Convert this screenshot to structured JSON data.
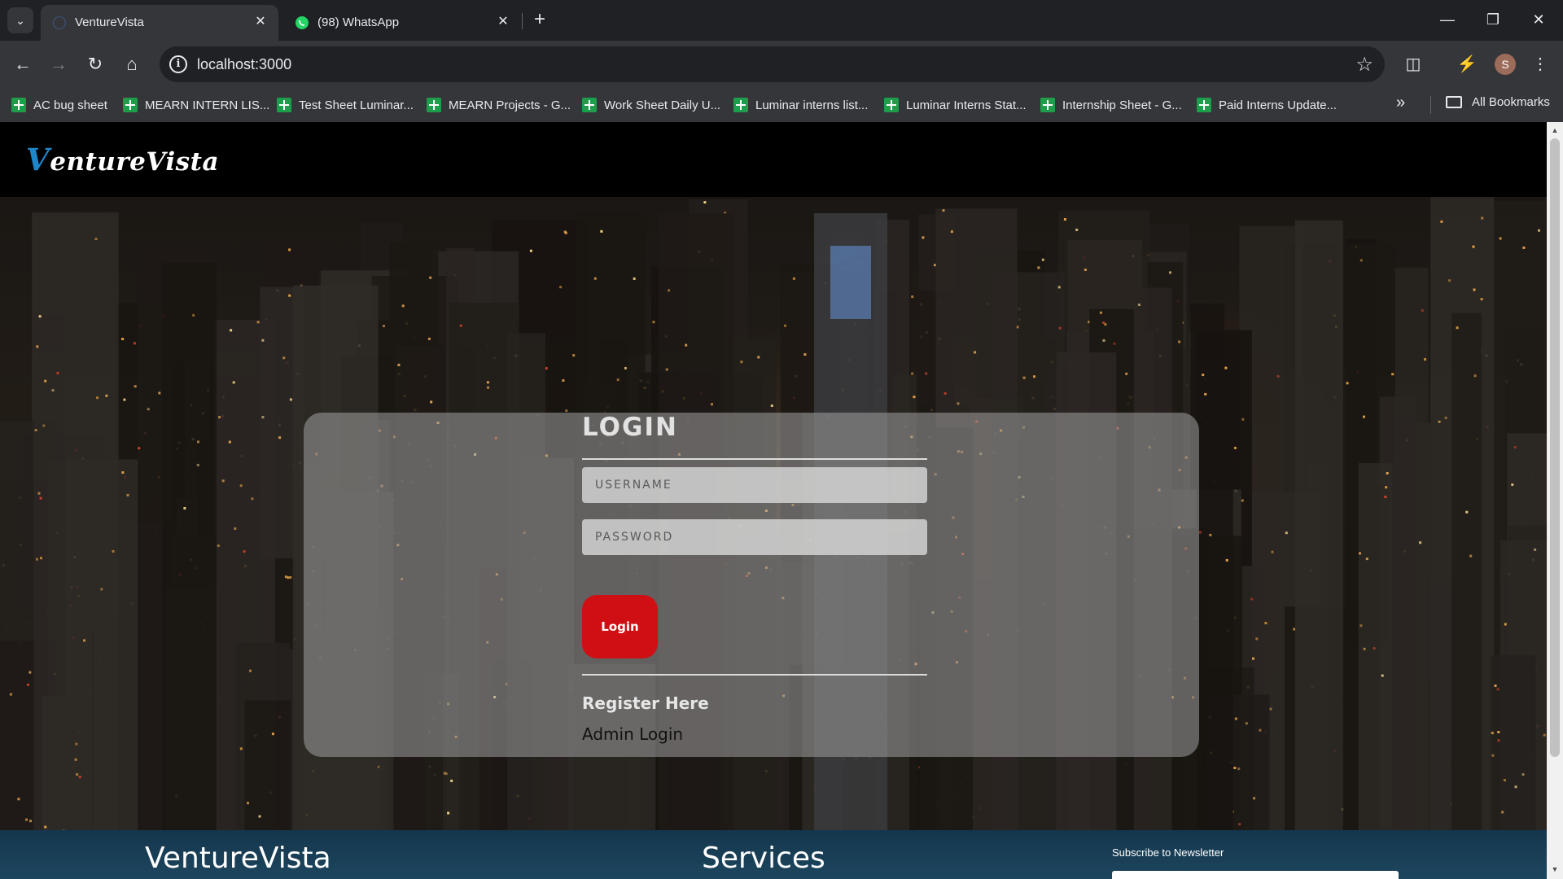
{
  "browser": {
    "tabs": [
      {
        "title": "VentureVista",
        "active": true,
        "favicon": "globe-icon"
      },
      {
        "title": "(98) WhatsApp",
        "active": false,
        "favicon": "whatsapp-icon"
      }
    ],
    "url": "localhost:3000",
    "profile_initial": "S",
    "bookmarks": [
      "AC bug sheet",
      "MEARN INTERN LIS...",
      "Test Sheet Luminar...",
      "MEARN Projects - G...",
      "Work Sheet Daily U...",
      "Luminar interns list...",
      "Luminar Interns Stat...",
      "Internship Sheet - G...",
      "Paid Interns Update..."
    ],
    "all_bookmarks_label": "All Bookmarks"
  },
  "site": {
    "logo_initial": "V",
    "logo_rest": "entureVista"
  },
  "login": {
    "title": "LOGIN",
    "username_placeholder": "USERNAME",
    "password_placeholder": "PASSWORD",
    "button_label": "Login",
    "register_label": "Register Here",
    "admin_label": "Admin Login"
  },
  "footer": {
    "brand": "VentureVista",
    "services_heading": "Services",
    "newsletter_label": "Subscribe to Newsletter"
  },
  "colors": {
    "accent_blue": "#1e86c8",
    "login_button": "#cf0f14",
    "footer_bg": "#1d465e"
  }
}
